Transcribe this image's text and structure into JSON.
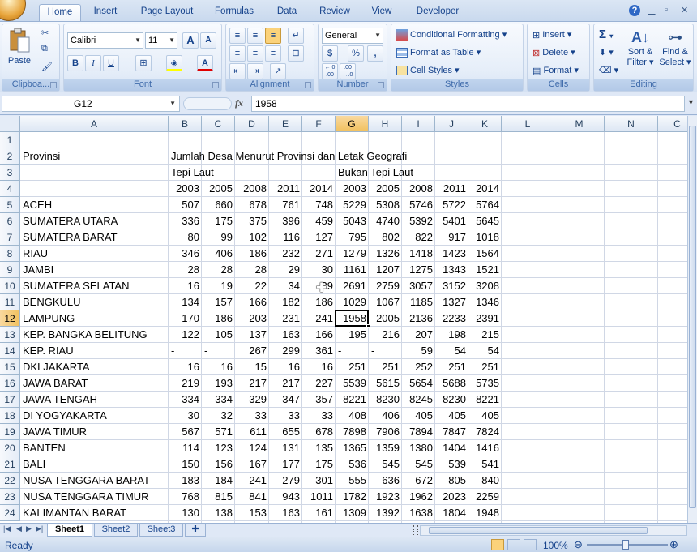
{
  "ribbon_tabs": [
    "Home",
    "Insert",
    "Page Layout",
    "Formulas",
    "Data",
    "Review",
    "View",
    "Developer"
  ],
  "clipboard": {
    "paste": "Paste",
    "group": "Clipboa..."
  },
  "font": {
    "name": "Calibri",
    "size": "11",
    "group": "Font",
    "bold": "B",
    "italic": "I",
    "underline": "U",
    "grow": "A",
    "shrink": "A"
  },
  "alignment": {
    "group": "Alignment"
  },
  "number": {
    "format": "General",
    "group": "Number",
    "currency": "$",
    "percent": "%",
    "comma": ",",
    "inc": "+.0 .00",
    "dec": ".00 →.0"
  },
  "styles": {
    "conditional": "Conditional Formatting",
    "table": "Format as Table",
    "cell": "Cell Styles",
    "group": "Styles"
  },
  "cells": {
    "insert": "Insert",
    "delete": "Delete",
    "format": "Format",
    "group": "Cells"
  },
  "editing": {
    "sigma": "Σ",
    "sort": "Sort &",
    "filter": "Filter",
    "find": "Find &",
    "select": "Select",
    "group": "Editing"
  },
  "formula_bar": {
    "name_box": "G12",
    "fx": "fx",
    "value": "1958"
  },
  "columns": [
    "A",
    "B",
    "C",
    "D",
    "E",
    "F",
    "G",
    "H",
    "I",
    "J",
    "K",
    "L",
    "M",
    "N",
    "C"
  ],
  "rows": [
    {
      "n": "1",
      "a": "",
      "v": [
        "",
        "",
        "",
        "",
        "",
        "",
        "",
        "",
        "",
        ""
      ]
    },
    {
      "n": "2",
      "a": "Provinsi",
      "b": "Jumlah Desa Menurut Provinsi dan Letak Geografi",
      "v": [
        "",
        "",
        "",
        "",
        "",
        "",
        "",
        "",
        "",
        ""
      ]
    },
    {
      "n": "3",
      "a": "",
      "b": "Tepi Laut",
      "g": "Bukan Tepi Laut",
      "v": [
        "",
        "",
        "",
        "",
        "",
        "",
        "",
        "",
        "",
        ""
      ]
    },
    {
      "n": "4",
      "a": "",
      "v": [
        "2003",
        "2005",
        "2008",
        "2011",
        "2014",
        "2003",
        "2005",
        "2008",
        "2011",
        "2014"
      ]
    },
    {
      "n": "5",
      "a": "ACEH",
      "v": [
        "507",
        "660",
        "678",
        "761",
        "748",
        "5229",
        "5308",
        "5746",
        "5722",
        "5764"
      ]
    },
    {
      "n": "6",
      "a": "SUMATERA UTARA",
      "v": [
        "336",
        "175",
        "375",
        "396",
        "459",
        "5043",
        "4740",
        "5392",
        "5401",
        "5645"
      ]
    },
    {
      "n": "7",
      "a": "SUMATERA BARAT",
      "v": [
        "80",
        "99",
        "102",
        "116",
        "127",
        "795",
        "802",
        "822",
        "917",
        "1018"
      ]
    },
    {
      "n": "8",
      "a": "RIAU",
      "v": [
        "346",
        "406",
        "186",
        "232",
        "271",
        "1279",
        "1326",
        "1418",
        "1423",
        "1564"
      ]
    },
    {
      "n": "9",
      "a": "JAMBI",
      "v": [
        "28",
        "28",
        "28",
        "29",
        "30",
        "1161",
        "1207",
        "1275",
        "1343",
        "1521"
      ]
    },
    {
      "n": "10",
      "a": "SUMATERA SELATAN",
      "v": [
        "16",
        "19",
        "22",
        "34",
        "39",
        "2691",
        "2759",
        "3057",
        "3152",
        "3208"
      ]
    },
    {
      "n": "11",
      "a": "BENGKULU",
      "v": [
        "134",
        "157",
        "166",
        "182",
        "186",
        "1029",
        "1067",
        "1185",
        "1327",
        "1346"
      ]
    },
    {
      "n": "12",
      "a": "LAMPUNG",
      "v": [
        "170",
        "186",
        "203",
        "231",
        "241",
        "1958",
        "2005",
        "2136",
        "2233",
        "2391"
      ]
    },
    {
      "n": "13",
      "a": "KEP. BANGKA BELITUNG",
      "v": [
        "122",
        "105",
        "137",
        "163",
        "166",
        "195",
        "216",
        "207",
        "198",
        "215"
      ]
    },
    {
      "n": "14",
      "a": "KEP. RIAU",
      "v": [
        "-",
        "-",
        "267",
        "299",
        "361",
        "-",
        "-",
        "59",
        "54",
        "54"
      ]
    },
    {
      "n": "15",
      "a": "DKI JAKARTA",
      "v": [
        "16",
        "16",
        "15",
        "16",
        "16",
        "251",
        "251",
        "252",
        "251",
        "251"
      ]
    },
    {
      "n": "16",
      "a": "JAWA BARAT",
      "v": [
        "219",
        "193",
        "217",
        "217",
        "227",
        "5539",
        "5615",
        "5654",
        "5688",
        "5735"
      ]
    },
    {
      "n": "17",
      "a": "JAWA TENGAH",
      "v": [
        "334",
        "334",
        "329",
        "347",
        "357",
        "8221",
        "8230",
        "8245",
        "8230",
        "8221"
      ]
    },
    {
      "n": "18",
      "a": "DI YOGYAKARTA",
      "v": [
        "30",
        "32",
        "33",
        "33",
        "33",
        "408",
        "406",
        "405",
        "405",
        "405"
      ]
    },
    {
      "n": "19",
      "a": "JAWA TIMUR",
      "v": [
        "567",
        "571",
        "611",
        "655",
        "678",
        "7898",
        "7906",
        "7894",
        "7847",
        "7824"
      ]
    },
    {
      "n": "20",
      "a": "BANTEN",
      "v": [
        "114",
        "123",
        "124",
        "131",
        "135",
        "1365",
        "1359",
        "1380",
        "1404",
        "1416"
      ]
    },
    {
      "n": "21",
      "a": "BALI",
      "v": [
        "150",
        "156",
        "167",
        "177",
        "175",
        "536",
        "545",
        "545",
        "539",
        "541"
      ]
    },
    {
      "n": "22",
      "a": "NUSA TENGGARA BARAT",
      "v": [
        "183",
        "184",
        "241",
        "279",
        "301",
        "555",
        "636",
        "672",
        "805",
        "840"
      ]
    },
    {
      "n": "23",
      "a": "NUSA TENGGARA TIMUR",
      "v": [
        "768",
        "815",
        "841",
        "943",
        "1011",
        "1782",
        "1923",
        "1962",
        "2023",
        "2259"
      ]
    },
    {
      "n": "24",
      "a": "KALIMANTAN BARAT",
      "v": [
        "130",
        "138",
        "153",
        "163",
        "161",
        "1309",
        "1392",
        "1638",
        "1804",
        "1948"
      ]
    }
  ],
  "sheets": [
    "Sheet1",
    "Sheet2",
    "Sheet3"
  ],
  "status": {
    "ready": "Ready",
    "zoom": "100%"
  }
}
